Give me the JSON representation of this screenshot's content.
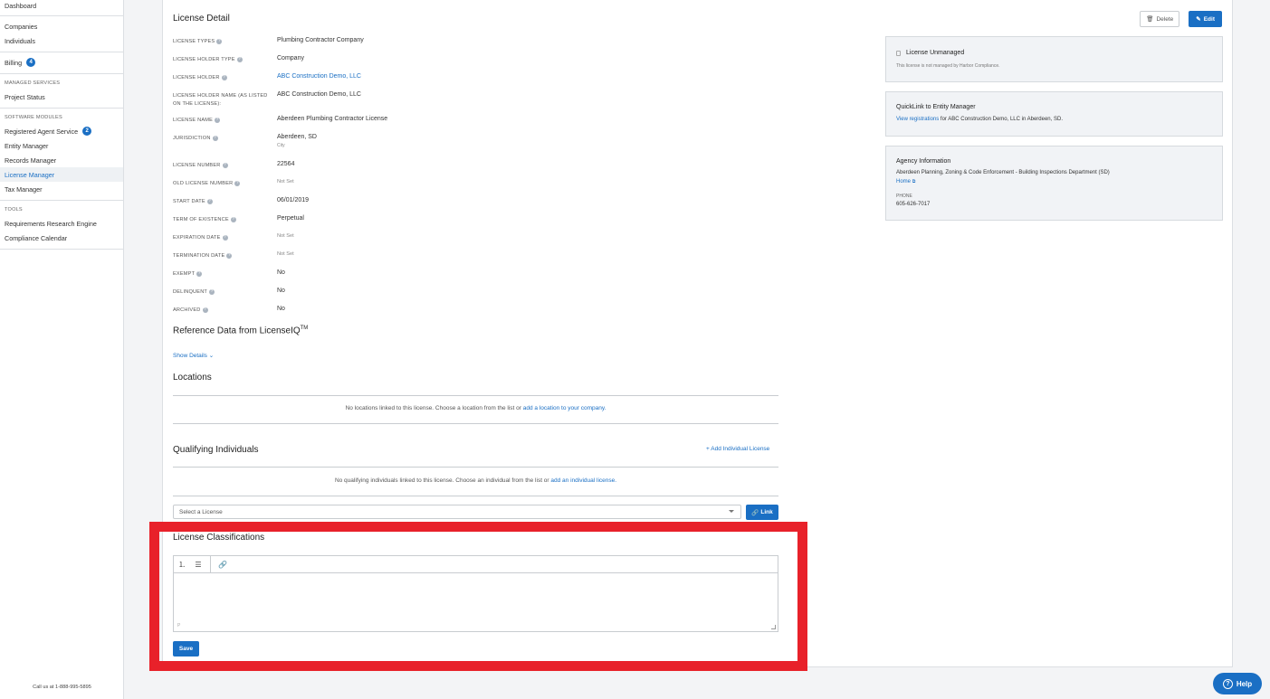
{
  "sidebar": {
    "items": {
      "dashboard": "Dashboard",
      "companies": "Companies",
      "individuals": "Individuals",
      "billing": "Billing",
      "billing_badge": "4",
      "managed_services_head": "MANAGED SERVICES",
      "project_status": "Project Status",
      "software_modules_head": "SOFTWARE MODULES",
      "registered_agent": "Registered Agent Service",
      "registered_agent_badge": "2",
      "entity_manager": "Entity Manager",
      "records_manager": "Records Manager",
      "license_manager": "License Manager",
      "tax_manager": "Tax Manager",
      "tools_head": "TOOLS",
      "requirements_engine": "Requirements Research Engine",
      "compliance_calendar": "Compliance Calendar"
    },
    "footer": "Call us at 1-888-995-5895"
  },
  "header": {
    "title": "License Detail",
    "delete_label": "Delete",
    "edit_label": "Edit"
  },
  "fields": {
    "license_types": {
      "label": "LICENSE TYPES",
      "value": "Plumbing Contractor Company"
    },
    "holder_type": {
      "label": "LICENSE HOLDER TYPE",
      "value": "Company"
    },
    "holder": {
      "label": "LICENSE HOLDER",
      "value": "ABC Construction Demo, LLC"
    },
    "holder_name": {
      "label": "LICENSE HOLDER NAME (AS LISTED ON THE LICENSE):",
      "value": "ABC Construction Demo, LLC"
    },
    "license_name": {
      "label": "LICENSE NAME",
      "value": "Aberdeen Plumbing Contractor License"
    },
    "jurisdiction": {
      "label": "JURISDICTION",
      "value": "Aberdeen, SD",
      "sub": "City"
    },
    "license_number": {
      "label": "LICENSE NUMBER",
      "value": "22564"
    },
    "old_license_number": {
      "label": "OLD LICENSE NUMBER",
      "value": "Not Set"
    },
    "start_date": {
      "label": "START DATE",
      "value": "06/01/2019"
    },
    "term": {
      "label": "TERM OF EXISTENCE",
      "value": "Perpetual"
    },
    "expiration": {
      "label": "EXPIRATION DATE",
      "value": "Not Set"
    },
    "termination": {
      "label": "TERMINATION DATE",
      "value": "Not Set"
    },
    "exempt": {
      "label": "EXEMPT",
      "value": "No"
    },
    "delinquent": {
      "label": "DELINQUENT",
      "value": "No"
    },
    "archived": {
      "label": "ARCHIVED",
      "value": "No"
    }
  },
  "reference": {
    "title": "Reference Data from LicenseIQ",
    "tm": "TM",
    "show_details": "Show Details"
  },
  "locations": {
    "title": "Locations",
    "empty_prefix": "No locations linked to this license. Choose a location from the list or ",
    "empty_link": "add a location to your company."
  },
  "qualifying": {
    "title": "Qualifying Individuals",
    "add_label": "Add Individual License",
    "empty_prefix": "No qualifying individuals linked to this license. Choose an individual from the list or ",
    "empty_link": "add an individual license.",
    "select_placeholder": "Select a License",
    "link_label": "Link"
  },
  "classifications": {
    "title": "License Classifications",
    "editor_p": "P",
    "save_label": "Save"
  },
  "cards": {
    "unmanaged": {
      "title": "License Unmanaged",
      "text": "This license is not managed by Harbor Compliance."
    },
    "quicklink": {
      "title": "QuickLink to Entity Manager",
      "link": "View registrations",
      "text": " for ABC Construction Demo, LLC in Aberdeen, SD."
    },
    "agency": {
      "title": "Agency Information",
      "name": "Aberdeen Planning, Zoning & Code Enforcement - Building Inspections Department (SD)",
      "home": "Home",
      "phone_label": "PHONE",
      "phone": "605-626-7017"
    }
  },
  "help": {
    "label": "Help"
  },
  "colors": {
    "accent": "#1a6fc4",
    "highlight": "#e8212a"
  }
}
